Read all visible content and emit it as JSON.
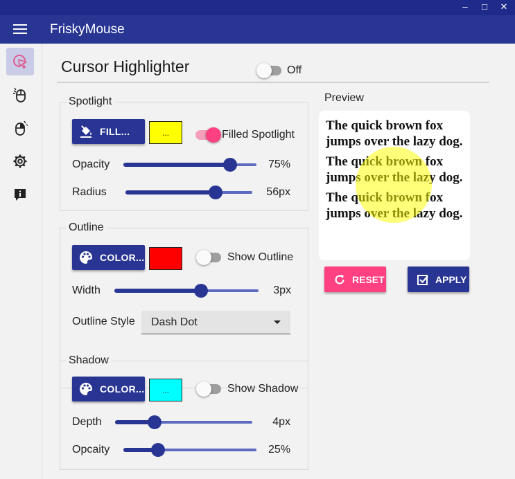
{
  "window": {
    "minimize": "–",
    "maximize": "□",
    "close": "✕"
  },
  "app": {
    "title": "FriskyMouse"
  },
  "sidebar": {
    "items": [
      {
        "icon": "cursor-highlight-icon",
        "active": true
      },
      {
        "icon": "mouse-click-icon",
        "active": false
      },
      {
        "icon": "mouse-right-icon",
        "active": false
      },
      {
        "icon": "gear-icon",
        "active": false
      },
      {
        "icon": "info-icon",
        "active": false
      }
    ]
  },
  "page": {
    "title": "Cursor Highlighter",
    "toggle_label": "Off",
    "enabled": false
  },
  "spotlight": {
    "title": "Spotlight",
    "fill_button": "FILL...",
    "swatch_color": "#ffff00",
    "swatch_text": "...",
    "filled_label": "Filled Spotlight",
    "filled_on": true,
    "opacity_label": "Opacity",
    "opacity_value": "75%",
    "opacity": 75,
    "radius_label": "Radius",
    "radius_value": "56px",
    "radius": 56
  },
  "outline": {
    "title": "Outline",
    "color_button": "COLOR...",
    "swatch_color": "#ff0000",
    "show_label": "Show Outline",
    "show_on": false,
    "width_label": "Width",
    "width_value": "3px",
    "width": 3,
    "style_label": "Outline Style",
    "style_value": "Dash Dot"
  },
  "shadow": {
    "title": "Shadow",
    "color_button": "COLOR...",
    "swatch_color": "#00ffff",
    "swatch_text": "...",
    "show_label": "Show Shadow",
    "show_on": false,
    "depth_label": "Depth",
    "depth_value": "4px",
    "depth": 4,
    "opacity_label": "Opcaity",
    "opacity_value": "25%",
    "opacity": 25
  },
  "preview": {
    "label": "Preview",
    "lines": [
      "The quick brown fox jumps over the lazy dog.",
      "The quick brown fox jumps over the lazy dog.",
      "The quick brown fox jumps over the lazy dog."
    ]
  },
  "actions": {
    "reset": "RESET",
    "apply": "APPLY",
    "reset_color": "#ff4081",
    "apply_color": "#283593"
  }
}
